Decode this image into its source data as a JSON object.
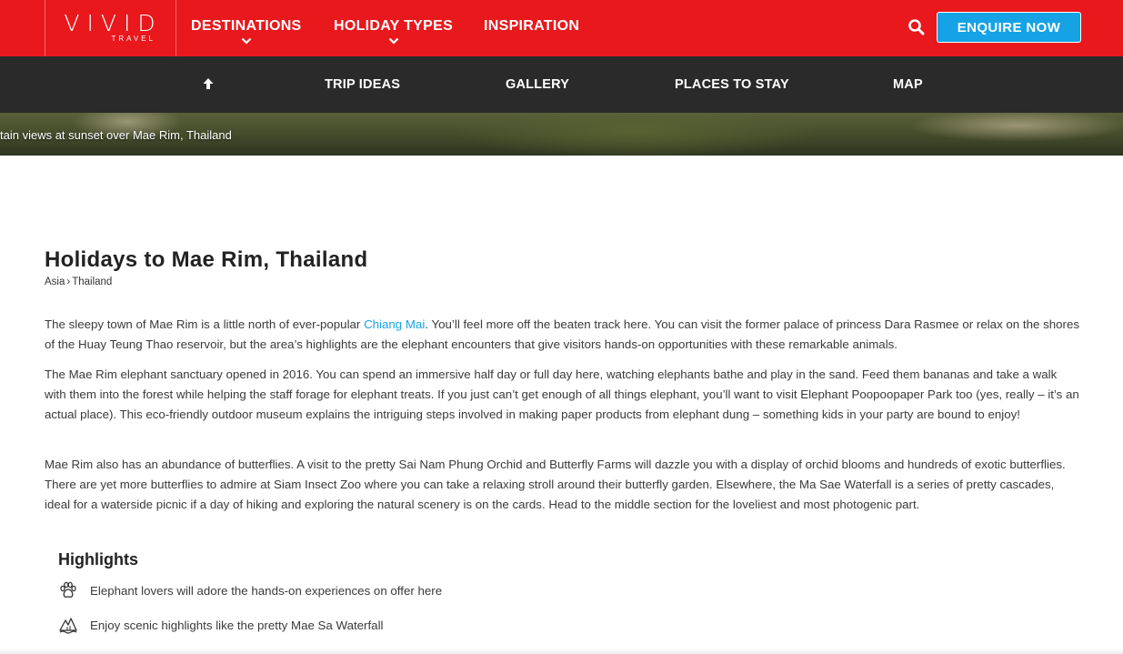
{
  "header": {
    "logo_main": "VIVID",
    "logo_sub": "TRAVEL",
    "nav": [
      {
        "label": "DESTINATIONS"
      },
      {
        "label": "HOLIDAY TYPES"
      },
      {
        "label": "INSPIRATION"
      }
    ],
    "enquire_label": "ENQUIRE NOW",
    "search_icon": "search-icon"
  },
  "subnav": {
    "back_to_top_icon": "arrow-up-icon",
    "items": [
      {
        "label": "TRIP IDEAS"
      },
      {
        "label": "GALLERY"
      },
      {
        "label": "PLACES TO STAY"
      },
      {
        "label": "MAP"
      }
    ]
  },
  "hero": {
    "caption": "tain views at sunset over Mae Rim, Thailand"
  },
  "main": {
    "title": "Holidays to Mae Rim, Thailand",
    "breadcrumb": {
      "level1": "Asia",
      "separator": "›",
      "level2": "Thailand"
    },
    "p1_before": "The sleepy town of Mae Rim is a little north of ever-popular ",
    "p1_link": "Chiang Mai",
    "p1_after": ". You’ll feel more off the beaten track here. You can visit the former palace of princess Dara Rasmee or relax on the shores of the Huay Teung Thao reservoir, but the area’s highlights are the elephant encounters that give visitors hands-on opportunities with these remarkable animals.",
    "p2": "The Mae Rim elephant sanctuary opened in 2016. You can spend an immersive half day or full day here, watching elephants bathe and play in the sand. Feed them bananas and take a walk with them into the forest while helping the staff forage for elephant treats. If you just can’t get enough of all things elephant, you’ll want to visit Elephant Poopoopaper Park too (yes, really – it’s an actual place). This eco-friendly outdoor museum explains the intriguing steps involved in making paper products from elephant dung – something kids in your party are bound to enjoy!",
    "p3": "Mae Rim also has an abundance of butterflies. A visit to the pretty Sai Nam Phung Orchid and Butterfly Farms will dazzle you with a display of orchid blooms and hundreds of exotic butterflies. There are yet more butterflies to admire at Siam Insect Zoo where you can take a relaxing stroll around their butterfly garden. Elsewhere, the Ma Sae Waterfall is a series of pretty cascades, ideal for a waterside picnic if a day of hiking and exploring the natural scenery is on the cards. Head to the middle section for the loveliest and most photogenic part."
  },
  "highlights": {
    "title": "Highlights",
    "items": [
      {
        "icon": "paw-icon",
        "text": "Elephant lovers will adore the hands-on experiences on offer here"
      },
      {
        "icon": "waterfall-icon",
        "text": "Enjoy scenic highlights like the pretty Mae Sa Waterfall"
      }
    ]
  },
  "colors": {
    "brand_red": "#e8181c",
    "accent_blue": "#15a3e6",
    "subnav_bg": "#2a2a2a"
  }
}
